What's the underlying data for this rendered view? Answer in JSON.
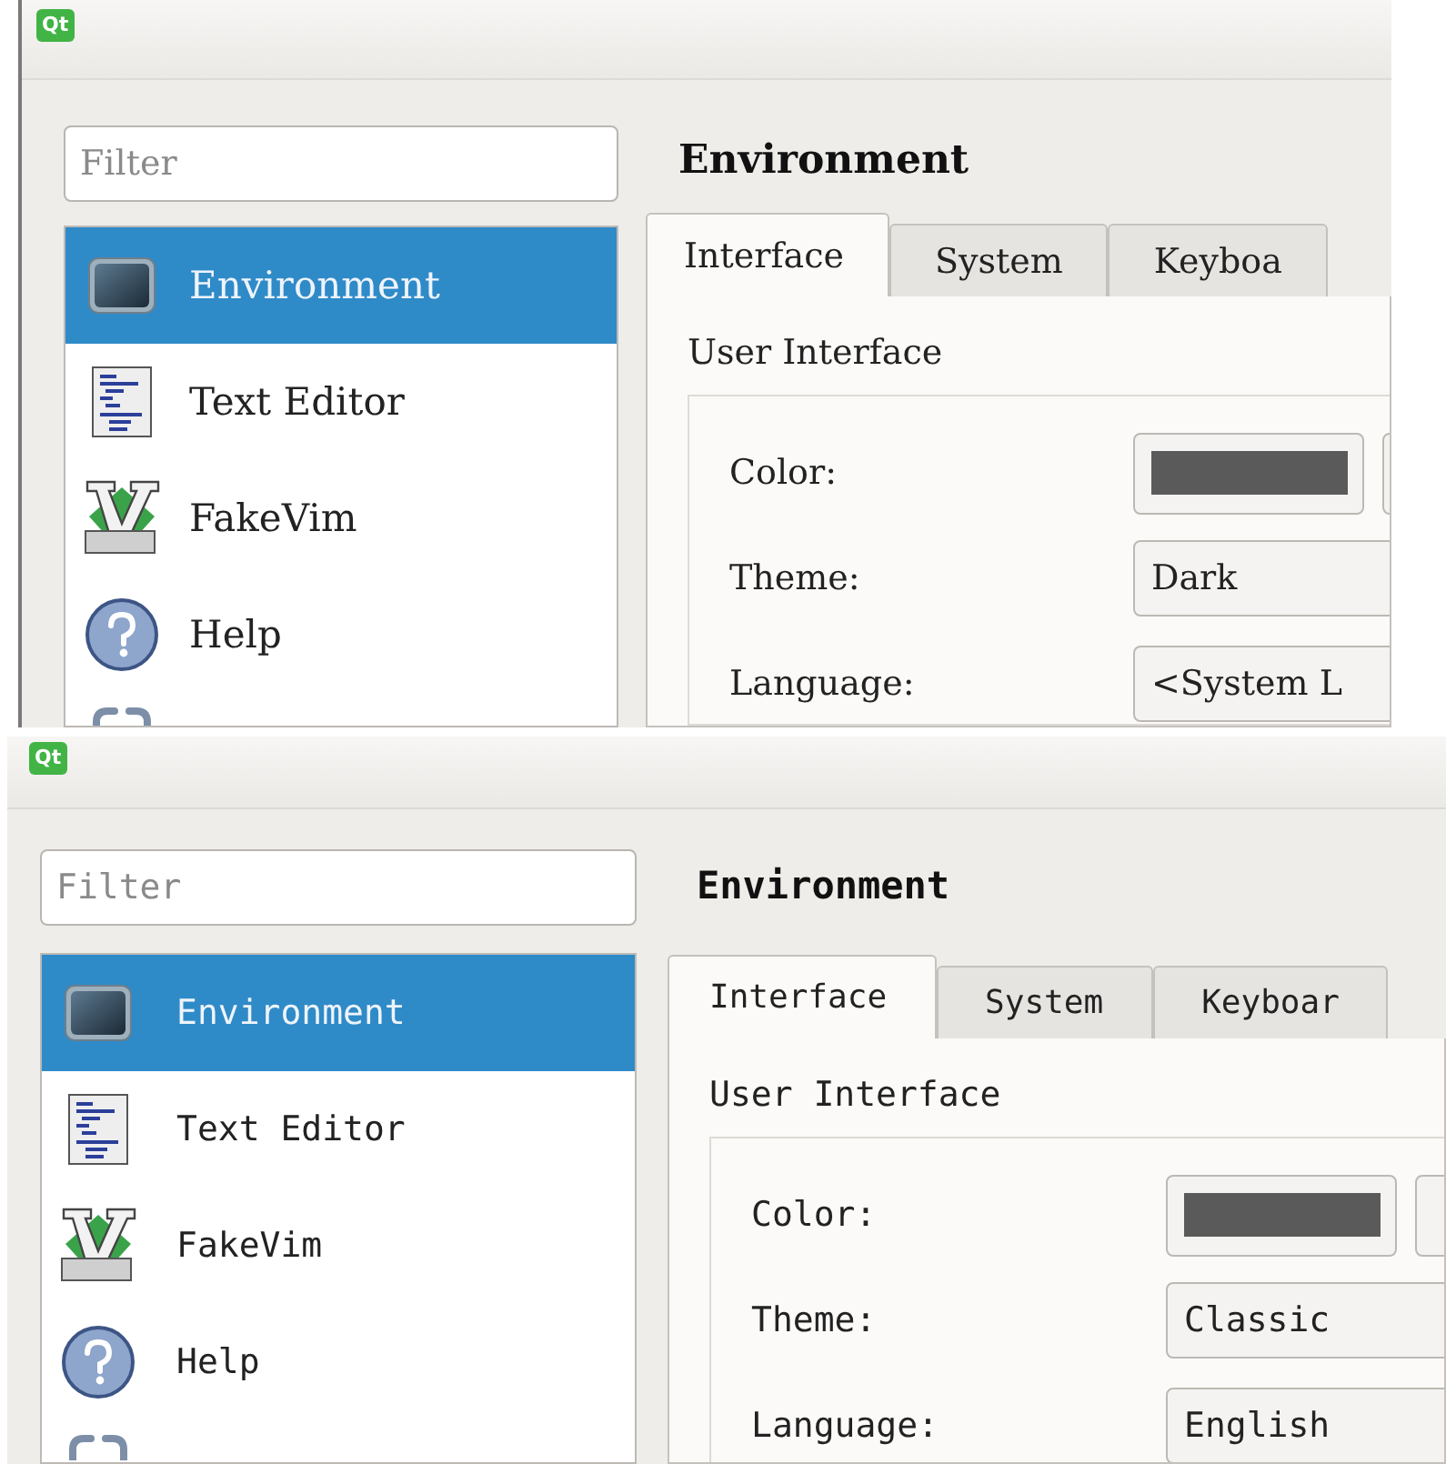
{
  "panels": [
    {
      "kind": "serif",
      "logo": "Qt",
      "filter": {
        "placeholder": "Filter"
      },
      "sidebar": {
        "items": [
          {
            "kind": "monitor",
            "label": "Environment",
            "selected": true
          },
          {
            "kind": "document",
            "label": "Text Editor",
            "selected": false
          },
          {
            "kind": "vim",
            "label": "FakeVim",
            "selected": false
          },
          {
            "kind": "help",
            "label": "Help",
            "selected": false
          },
          {
            "kind": "chain",
            "selected": false
          }
        ]
      },
      "page_title": "Environment",
      "tabs": [
        {
          "label": "Interface",
          "selected": true
        },
        {
          "label": "System",
          "selected": false
        },
        {
          "label": "Keyboa",
          "selected": false
        }
      ],
      "section": "User Interface",
      "fields": [
        {
          "kind": "color",
          "label": "Color:"
        },
        {
          "kind": "combo",
          "label": "Theme:",
          "value": "Dark"
        },
        {
          "kind": "combo",
          "label": "Language:",
          "value": "<System L"
        }
      ]
    },
    {
      "kind": "mono",
      "logo": "Qt",
      "filter": {
        "placeholder": "Filter"
      },
      "sidebar": {
        "items": [
          {
            "kind": "monitor",
            "label": "Environment",
            "selected": true
          },
          {
            "kind": "document",
            "label": "Text Editor",
            "selected": false
          },
          {
            "kind": "vim",
            "label": "FakeVim",
            "selected": false
          },
          {
            "kind": "help",
            "label": "Help",
            "selected": false
          },
          {
            "kind": "chain",
            "selected": false
          }
        ]
      },
      "page_title": "Environment",
      "tabs": [
        {
          "label": "Interface",
          "selected": true
        },
        {
          "label": "System",
          "selected": false
        },
        {
          "label": "Keyboar",
          "selected": false
        }
      ],
      "section": "User Interface",
      "fields": [
        {
          "kind": "color",
          "label": "Color:"
        },
        {
          "kind": "combo",
          "label": "Theme:",
          "value": "Classic"
        },
        {
          "kind": "combo",
          "label": "Language:",
          "value": "English"
        }
      ]
    }
  ]
}
